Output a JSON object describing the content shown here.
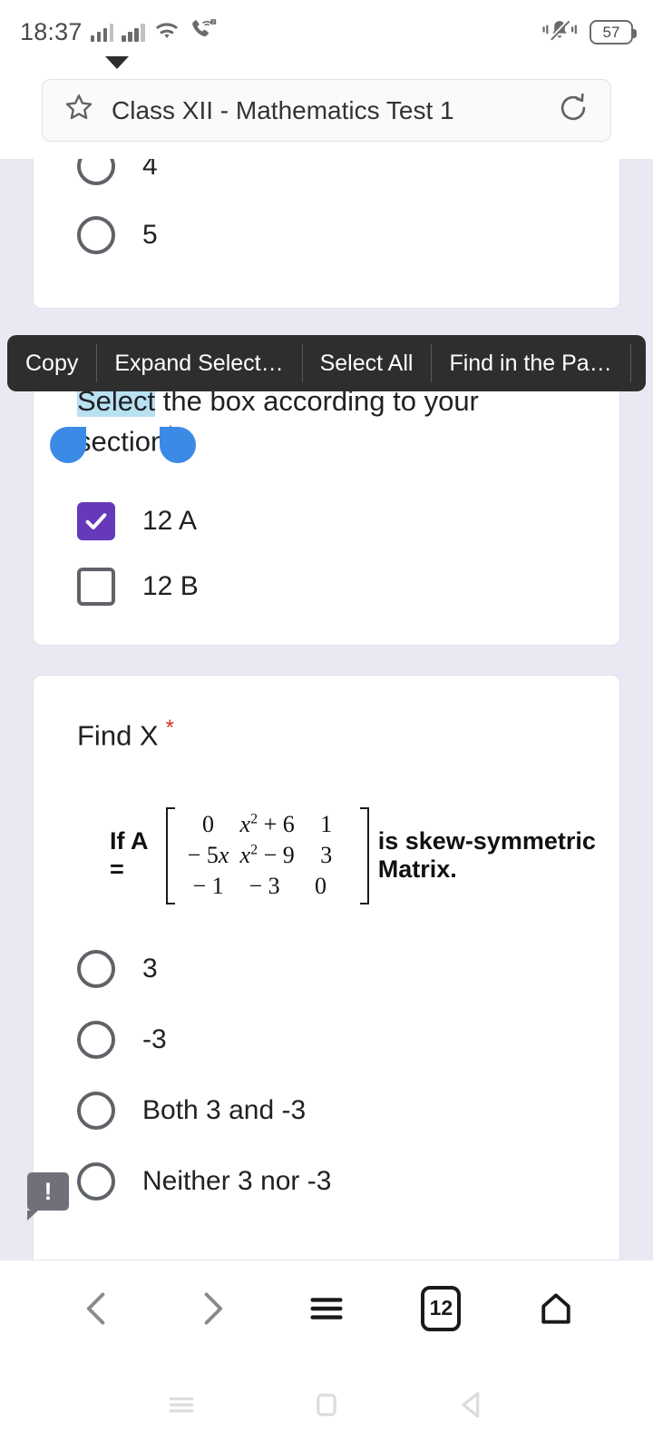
{
  "status_bar": {
    "time": "18:37",
    "battery_percent": "57",
    "icons": [
      "signal-bars-sim1",
      "signal-bars-sim2",
      "wifi-icon",
      "wifi-calling-icon",
      "silent-bell-icon",
      "battery-icon"
    ],
    "wifi_calling_badge": "2"
  },
  "browser": {
    "title": "Class XII - Mathematics Test 1",
    "bookmark_icon": "star-icon",
    "reload_icon": "reload-icon",
    "toolbar": {
      "back_label": "Back",
      "forward_label": "Forward",
      "menu_label": "Menu",
      "tab_count": "12",
      "home_label": "Home"
    }
  },
  "context_menu": {
    "items": [
      {
        "label": "Copy"
      },
      {
        "label": "Expand Select…"
      },
      {
        "label": "Select All"
      },
      {
        "label": "Find in the Pa…"
      }
    ],
    "more_icon": "play-arrow-icon"
  },
  "form": {
    "card_top": {
      "options": [
        {
          "label": "4",
          "selected": false
        },
        {
          "label": "5",
          "selected": false
        }
      ]
    },
    "card_section": {
      "question_selected_part": "Select",
      "question_rest": " the box according to your section",
      "required_marker": "*",
      "checkboxes": [
        {
          "label": "12 A",
          "checked": true
        },
        {
          "label": "12 B",
          "checked": false
        }
      ]
    },
    "card_find_x": {
      "question": "Find X",
      "required_marker": "*",
      "prompt_prefix": "If A = ",
      "prompt_suffix": " is skew-symmetric Matrix.",
      "matrix": [
        [
          "0",
          "x² + 6",
          "1"
        ],
        [
          "− 5x",
          "x² − 9",
          "3"
        ],
        [
          "− 1",
          "− 3",
          "0"
        ]
      ],
      "options": [
        {
          "label": "3",
          "selected": false
        },
        {
          "label": "-3",
          "selected": false
        },
        {
          "label": "Both 3 and -3",
          "selected": false
        },
        {
          "label": "Neither 3 nor -3",
          "selected": false
        }
      ]
    }
  },
  "tooltip_badge": {
    "label": "!"
  },
  "android_nav": {
    "recents_label": "Recents",
    "home_label": "Home",
    "back_label": "Back"
  },
  "colors": {
    "page_background": "#ebe8f3",
    "card_background": "#ffffff",
    "checkbox_accent": "#6639ba",
    "selection_highlight": "#b8e1f2",
    "selection_handle": "#3b8ae6",
    "context_menu_bg": "#2e2e2e",
    "required_asterisk": "#d93025"
  }
}
